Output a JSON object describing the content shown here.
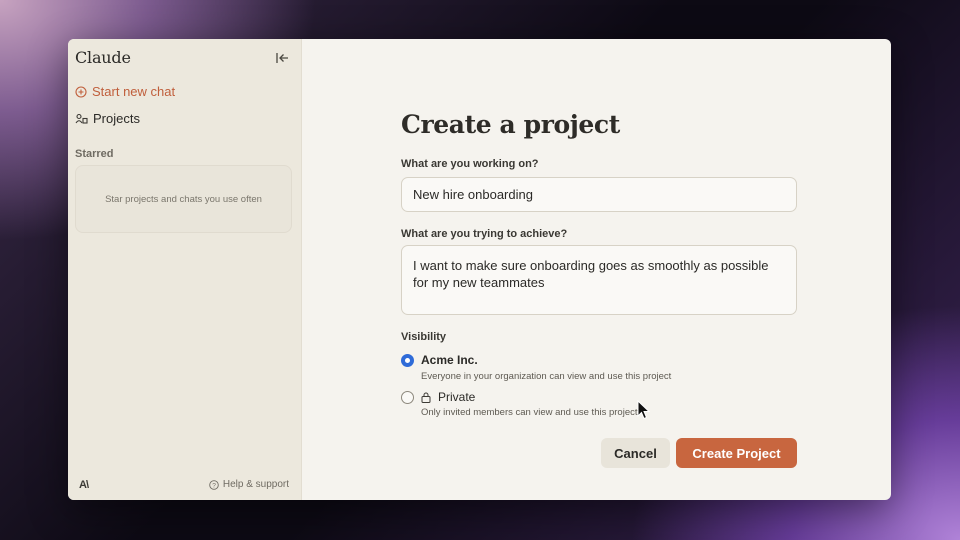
{
  "sidebar": {
    "brand": "Claude",
    "new_chat_label": "Start new chat",
    "projects_label": "Projects",
    "starred_label": "Starred",
    "starred_empty_text": "Star projects and chats you use often",
    "logo_text": "A\\",
    "help_label": "Help & support"
  },
  "form": {
    "title": "Create a project",
    "name_label": "What are you working on?",
    "name_value": "New hire onboarding",
    "goal_label": "What are you trying to achieve?",
    "goal_value": "I want to make sure onboarding goes as smoothly as possible for my new teammates",
    "visibility_label": "Visibility",
    "options": [
      {
        "title": "Acme Inc.",
        "description": "Everyone in your organization can view and use this project",
        "selected": true
      },
      {
        "title": "Private",
        "description": "Only invited members can view and use this project",
        "selected": false
      }
    ],
    "cancel_label": "Cancel",
    "create_label": "Create Project"
  },
  "colors": {
    "accent": "#c8663f",
    "new_chat": "#c05f3c",
    "radio_selected": "#2f6bd8"
  },
  "icons": [
    "collapse-sidebar-icon",
    "plus-circle-icon",
    "projects-icon",
    "help-icon",
    "lock-icon",
    "pointer-cursor-icon"
  ]
}
